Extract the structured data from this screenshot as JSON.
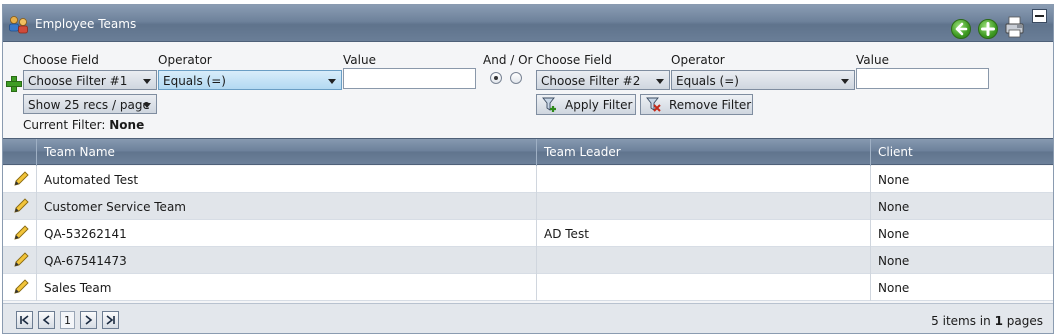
{
  "panel": {
    "title": "Employee Teams",
    "icons": {
      "title": "users-icon",
      "back": "back-arrow-icon",
      "add": "add-icon",
      "print": "print-icon",
      "minimize": "minimize-icon"
    }
  },
  "filter": {
    "choose_field_label": "Choose Field",
    "operator_label": "Operator",
    "value_label": "Value",
    "and_or_label": "And / Or",
    "filter1_field": "Choose Filter #1",
    "filter1_operator": "Equals (=)",
    "filter2_field": "Choose Filter #2",
    "filter2_operator": "Equals (=)",
    "page_size": "Show 25 recs / page",
    "current_filter_label": "Current Filter:",
    "current_filter_value": "None",
    "apply_label": "Apply Filter",
    "remove_label": "Remove Filter",
    "and_selected": true
  },
  "grid": {
    "columns": [
      "Team Name",
      "Team Leader",
      "Client"
    ],
    "rows": [
      {
        "team_name": "Automated Test",
        "team_leader": "",
        "client": "None"
      },
      {
        "team_name": "Customer Service Team",
        "team_leader": "",
        "client": "None"
      },
      {
        "team_name": "QA-53262141",
        "team_leader": "AD Test",
        "client": "None"
      },
      {
        "team_name": "QA-67541473",
        "team_leader": "",
        "client": "None"
      },
      {
        "team_name": "Sales Team",
        "team_leader": "",
        "client": "None"
      }
    ]
  },
  "pager": {
    "current_page": "1",
    "items_count": "5",
    "items_text": "items in",
    "pages_count": "1",
    "pages_text": "pages"
  }
}
